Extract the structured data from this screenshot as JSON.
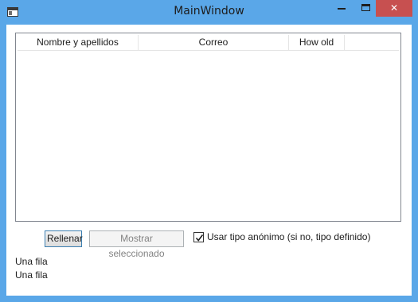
{
  "window": {
    "title": "MainWindow"
  },
  "titlebar": {
    "close_glyph": "✕",
    "icons": [
      "app-icon",
      "minimize-icon",
      "maximize-icon",
      "close-icon"
    ]
  },
  "listview": {
    "columns": [
      "Nombre y apellidos",
      "Correo",
      "How old"
    ],
    "rows": []
  },
  "buttons": {
    "fill_label": "Rellenar",
    "show_selected_label": "Mostrar seleccionado"
  },
  "checkbox": {
    "label": "Usar tipo anónimo (si no, tipo definido)",
    "checked": true
  },
  "output": {
    "lines": [
      "Una fila",
      "Una fila"
    ]
  },
  "colors": {
    "accent": "#5aa7e8",
    "close": "#c75050"
  }
}
